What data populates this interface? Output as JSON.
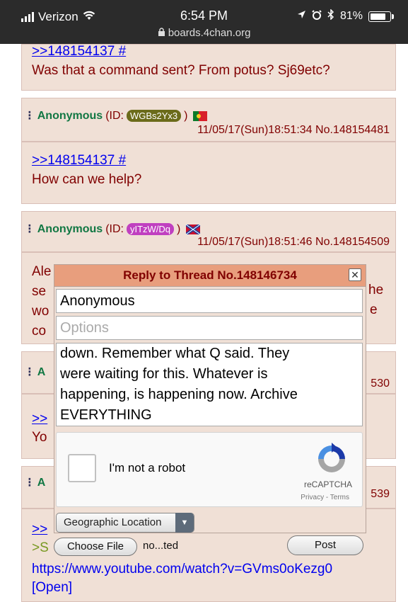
{
  "status_bar": {
    "carrier": "Verizon",
    "time": "6:54 PM",
    "url": "boards.4chan.org",
    "battery": "81%",
    "battery_level": 0.81
  },
  "posts": {
    "top": {
      "quote_link": ">>148154137 #",
      "message": "Was that a command sent? From potus? Sj69etc?"
    },
    "p1": {
      "name": "Anonymous",
      "id_prefix": "(ID:",
      "id": "WGBs2Yx3",
      "id_suffix": ")",
      "id_color": "#6b6b1a",
      "datetime": "11/05/17(Sun)18:51:34",
      "number": "No.148154481",
      "quote_link": ">>148154137 #",
      "message": "How can we help?"
    },
    "p2": {
      "name": "Anonymous",
      "id_prefix": "(ID:",
      "id": "yITzW/Dq",
      "id_suffix": ")",
      "id_color": "#c040c0",
      "datetime": "11/05/17(Sun)18:51:46",
      "number": "No.148154509",
      "partial_left": [
        "Ale",
        "se",
        "wo",
        "co"
      ],
      "partial_right": [
        "he",
        "e"
      ]
    },
    "p3": {
      "name_partial": "A",
      "number_partial": "530",
      "link_partial": ">>",
      "text_partial": "Yo"
    },
    "p4": {
      "name_partial": "A",
      "number_partial": "539",
      "link_partial": ">>",
      "text_partial": ">S",
      "url": "https://www.youtube.com/watch?v=GVms0oKezg0",
      "open": "[Open]"
    }
  },
  "reply_form": {
    "title": "Reply to Thread No.148146734",
    "name_value": "Anonymous",
    "options_placeholder": "Options",
    "comment_lines": [
      "down. Remember what Q said. They",
      "were waiting for this. Whatever is",
      "happening, is happening now. Archive",
      "EVERYTHING"
    ],
    "captcha_label": "I'm not a robot",
    "captcha_brand": "reCAPTCHA",
    "captcha_links": "Privacy - Terms",
    "location_select": "Geographic Location",
    "choose_file": "Choose File",
    "file_status": "no...ted",
    "post_button": "Post"
  },
  "colors": {
    "post_bg": "#f0e0d6",
    "name_green": "#117743",
    "text_maroon": "#800000",
    "title_bar": "#e89e7d",
    "link_blue": "#0000ee"
  }
}
